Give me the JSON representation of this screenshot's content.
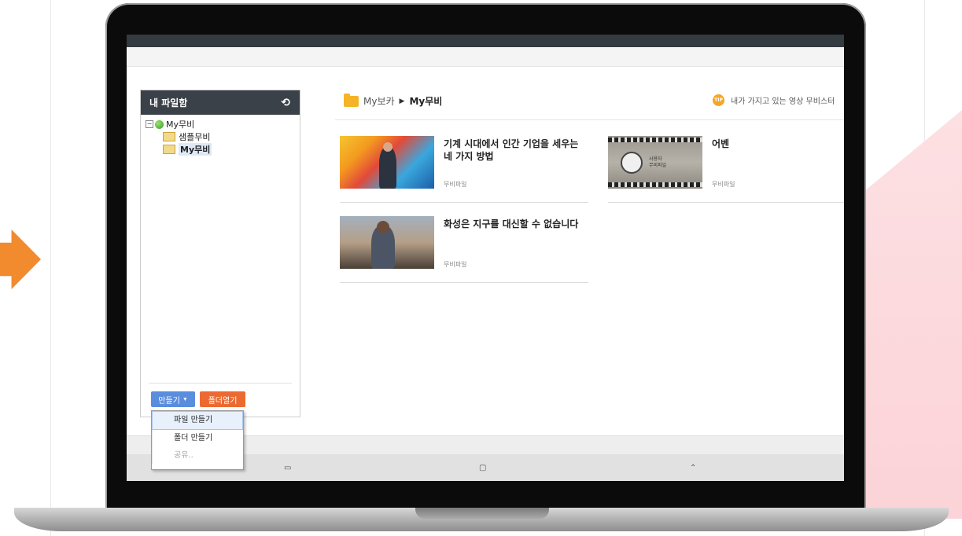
{
  "sidebar": {
    "title": "내 파일함",
    "refresh_icon": "refresh-icon",
    "tree": {
      "root": {
        "toggle": "⊟",
        "label": "My무비"
      },
      "children": [
        {
          "label": "샘플무비"
        },
        {
          "label": "My무비"
        }
      ]
    },
    "create_button": "만들기",
    "open_folder_button": "폴더열기"
  },
  "dropdown": {
    "items": [
      "파일 만들기",
      "폴더 만들기",
      "공유.."
    ]
  },
  "breadcrumb": {
    "parent": "My보카",
    "separator": "▶",
    "current": "My무비"
  },
  "tip": {
    "badge": "TIP",
    "text": "내가 가지고 있는 영상 무비스터"
  },
  "cards": [
    {
      "title": "기계 시대에서 인간 기업을 세우는 네 가지 방법",
      "type": "무비파일"
    },
    {
      "title": "어벤",
      "type": "무비파일",
      "thumb_text": "사용자\n무비파일"
    },
    {
      "title": "화성은 지구를 대신할 수 없습니다",
      "type": "무비파일"
    }
  ],
  "colors": {
    "arrow": "#f28a2e",
    "create_button": "#5a8ddd",
    "open_folder_button": "#ec6a32",
    "sidebar_header": "#3b4148",
    "folder": "#f5b328",
    "tip_badge": "#f5a623"
  }
}
